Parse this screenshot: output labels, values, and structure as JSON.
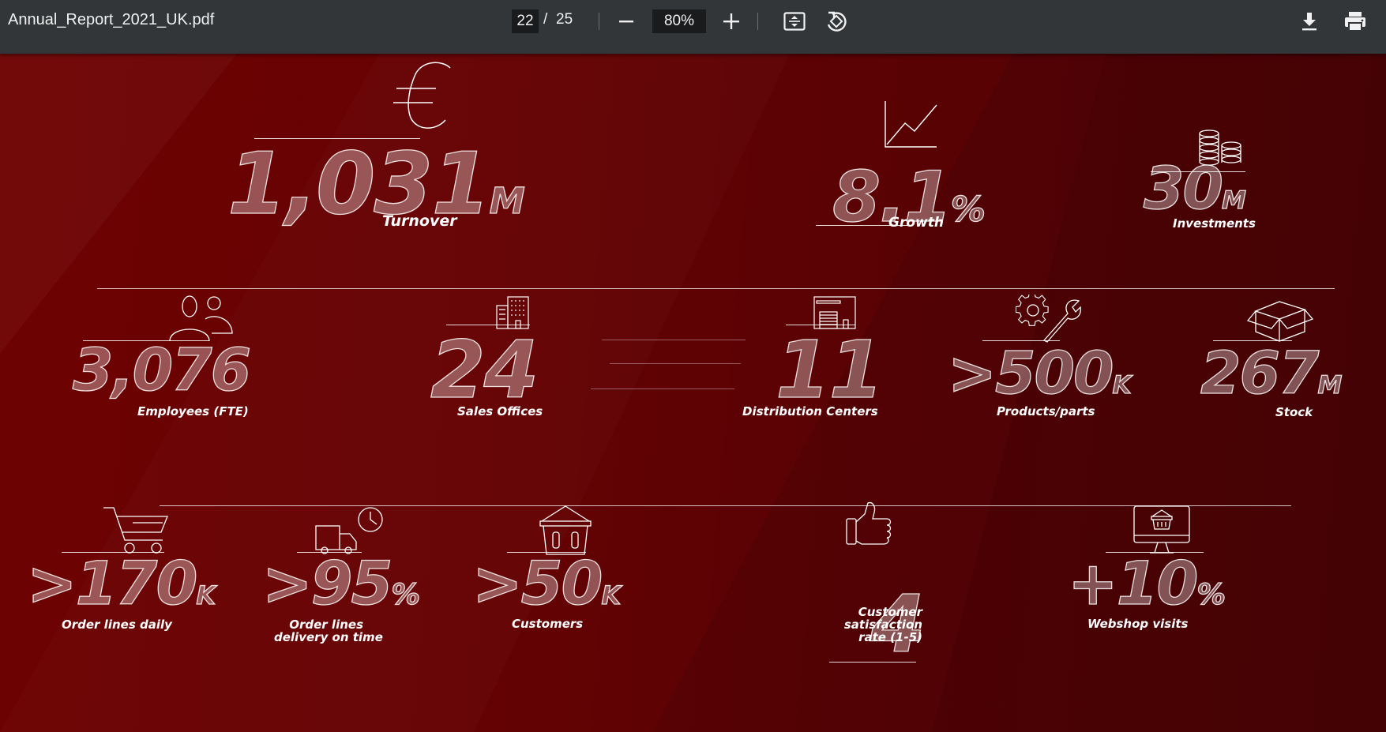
{
  "toolbar": {
    "file_name": "Annual_Report_2021_UK.pdf",
    "current_page": "22",
    "page_separator": "/",
    "total_pages": "25",
    "zoom": "80%",
    "icons": {
      "zoom_out": "minus-icon",
      "zoom_in": "plus-icon",
      "fit": "fit-page-icon",
      "rotate": "rotate-icon",
      "download": "download-icon",
      "print": "print-icon"
    }
  },
  "page": {
    "background_color": "#650203",
    "row1": {
      "turnover": {
        "value": "1,031",
        "unit": "M",
        "label": "Turnover",
        "icon": "euro-icon"
      },
      "growth": {
        "value": "8.1",
        "unit": "%",
        "label": "Growth",
        "icon": "line-chart-icon"
      },
      "investments": {
        "value": "30",
        "unit": "M",
        "label": "Investments",
        "icon": "coins-icon"
      }
    },
    "row2": {
      "employees": {
        "value": "3,076",
        "label": "Employees (FTE)",
        "icon": "people-icon"
      },
      "sales_offices": {
        "value": "24",
        "label": "Sales Offices",
        "icon": "office-building-icon"
      },
      "distribution_centers": {
        "value": "11",
        "label": "Distribution Centers",
        "icon": "warehouse-icon"
      },
      "products": {
        "value": ">500",
        "unit": "K",
        "label": "Products/parts",
        "icon": "gear-wrench-icon"
      },
      "stock": {
        "value": "267",
        "unit": "M",
        "label": "Stock",
        "icon": "box-icon"
      }
    },
    "row3": {
      "order_lines": {
        "value": ">170",
        "unit": "K",
        "label": "Order lines daily",
        "icon": "shopping-cart-icon"
      },
      "delivery": {
        "value": ">95",
        "unit": "%",
        "label_line1": "Order lines",
        "label_line2": "delivery on time",
        "icon": "truck-clock-icon"
      },
      "customers": {
        "value": ">50",
        "unit": "K",
        "label": "Customers",
        "icon": "shopping-basket-icon"
      },
      "satisfaction": {
        "value": "4",
        "label_line1": "Customer",
        "label_line2": "satisfaction",
        "label_line3": "rate (1-5)",
        "icon": "thumbs-up-icon"
      },
      "webshop": {
        "value": "+10",
        "unit": "%",
        "label": "Webshop visits",
        "icon": "monitor-basket-icon"
      }
    }
  }
}
